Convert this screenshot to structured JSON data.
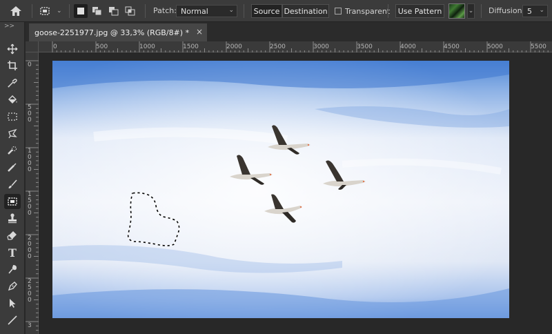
{
  "options_bar": {
    "patch_label": "Patch:",
    "patch_mode": "Normal",
    "source_label": "Source",
    "destination_label": "Destination",
    "transparent_label": "Transparent",
    "transparent_checked": false,
    "use_pattern_label": "Use Pattern",
    "diffusion_label": "Diffusion:",
    "diffusion_value": "5",
    "home_icon": "home-icon",
    "tool_preset_icon": "patch-tool-icon"
  },
  "toolbar": {
    "collapse_glyph": ">>",
    "tools": [
      {
        "name": "move-tool",
        "icon": "move-icon"
      },
      {
        "name": "crop-tool",
        "icon": "crop-icon"
      },
      {
        "name": "eyedropper-tool",
        "icon": "eyedropper-icon"
      },
      {
        "name": "paint-bucket-tool",
        "icon": "paint-bucket-icon"
      },
      {
        "name": "marquee-tool",
        "icon": "marquee-icon"
      },
      {
        "name": "lasso-tool",
        "icon": "lasso-icon"
      },
      {
        "name": "spot-healing-tool",
        "icon": "spot-healing-icon"
      },
      {
        "name": "healing-brush-tool",
        "icon": "healing-brush-icon"
      },
      {
        "name": "brush-tool",
        "icon": "brush-icon"
      },
      {
        "name": "patch-tool",
        "icon": "patch-icon",
        "active": true
      },
      {
        "name": "clone-stamp-tool",
        "icon": "stamp-icon"
      },
      {
        "name": "eraser-tool",
        "icon": "eraser-icon"
      },
      {
        "name": "type-tool",
        "icon": "type-icon",
        "glyph": "T"
      },
      {
        "name": "smudge-tool",
        "icon": "smudge-icon"
      },
      {
        "name": "pen-tool",
        "icon": "pen-icon"
      },
      {
        "name": "path-selection-tool",
        "icon": "arrow-icon"
      },
      {
        "name": "line-tool",
        "icon": "line-icon"
      }
    ]
  },
  "document": {
    "tab_title": "goose-2251977.jpg @ 33,3% (RGB/8#) *",
    "close_glyph": "×",
    "ruler_h": [
      "0",
      "500",
      "1000",
      "1500",
      "2000",
      "2500",
      "3000",
      "3500",
      "4000",
      "4500",
      "5000",
      "5500"
    ],
    "ruler_v": [
      "0",
      "5\n0\n0",
      "1\n0\n0\n0",
      "1\n5\n0\n0",
      "2\n0\n0\n0",
      "2\n5\n0\n0",
      "3"
    ]
  },
  "colors": {
    "sky_top": "#4f86d6",
    "sky_mid": "#e9eef8",
    "accent_active": "#1e1e1e"
  }
}
